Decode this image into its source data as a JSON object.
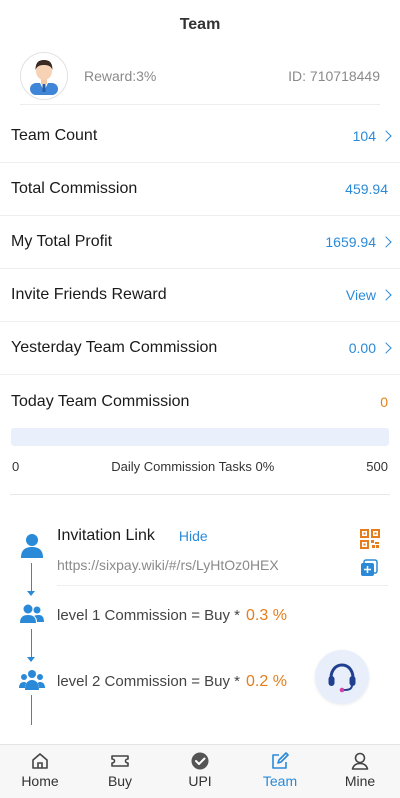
{
  "header": {
    "title": "Team"
  },
  "profile": {
    "reward": "Reward:3%",
    "id": "ID: 710718449"
  },
  "rows": [
    {
      "label": "Team Count",
      "value": "104"
    },
    {
      "label": "Total Commission",
      "value": "459.94"
    },
    {
      "label": "My Total Profit",
      "value": "1659.94"
    },
    {
      "label": "Invite Friends Reward",
      "value": "View"
    },
    {
      "label": "Yesterday Team Commission",
      "value": "0.00"
    },
    {
      "label": "Today Team Commission",
      "value": "0"
    }
  ],
  "progress": {
    "min": "0",
    "label": "Daily Commission Tasks 0%",
    "max": "500",
    "fraction": 0
  },
  "invite": {
    "title": "Invitation Link",
    "hide_label": "Hide",
    "link": "https://sixpay.wiki/#/rs/LyHtOz0HEX"
  },
  "levels": [
    {
      "text": "level 1 Commission = Buy *",
      "pct": "0.3 %"
    },
    {
      "text": "level 2 Commission = Buy *",
      "pct": "0.2 %"
    }
  ],
  "tabs": [
    {
      "label": "Home",
      "icon": "home-icon"
    },
    {
      "label": "Buy",
      "icon": "ticket-icon"
    },
    {
      "label": "UPI",
      "icon": "upi-check-icon"
    },
    {
      "label": "Team",
      "icon": "edit-icon",
      "active": true
    },
    {
      "label": "Mine",
      "icon": "person-icon"
    }
  ],
  "colors": {
    "accent": "#2a8ad8",
    "orange": "#e57e1a",
    "progress_track": "#eaf0fb"
  }
}
